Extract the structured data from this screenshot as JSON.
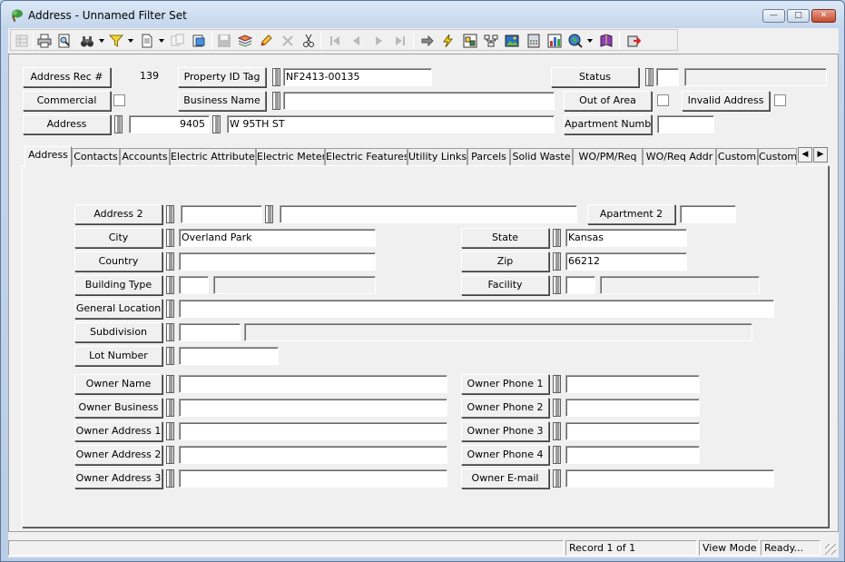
{
  "window": {
    "title": "Address - Unnamed Filter Set",
    "min": "—",
    "max": "□",
    "close": "✕"
  },
  "colors": {
    "accent": "#1e5fa8",
    "window_frame": "#5d7698",
    "close": "#c44a2f"
  },
  "toolbar": {
    "icons": [
      "table-icon",
      "print-icon",
      "print-preview-icon",
      "binoculars-icon",
      "filter-icon",
      "document-icon",
      "copy-icon",
      "open-icon",
      "save-icon",
      "layers-icon",
      "edit-icon",
      "delete-icon",
      "cut-icon",
      "first-record-icon",
      "previous-record-icon",
      "next-record-icon",
      "last-record-icon",
      "go-icon",
      "lightning-icon",
      "map-icon",
      "hierarchy-icon",
      "image-icon",
      "calculator-icon",
      "chart-icon",
      "globe-icon",
      "book-icon",
      "exit-icon"
    ]
  },
  "header": {
    "address_rec_label": "Address Rec #",
    "address_rec_value": "139",
    "property_id_label": "Property ID Tag",
    "property_id_value": "NF2413-00135",
    "status_label": "Status",
    "status_code": "",
    "status_desc": "",
    "commercial_label": "Commercial",
    "business_name_label": "Business Name",
    "business_name_value": "",
    "out_of_area_label": "Out of Area",
    "invalid_address_label": "Invalid Address",
    "address_label": "Address",
    "address_number": "9405",
    "address_street": "W 95TH ST",
    "apartment_number_label": "Apartment Number",
    "apartment_number_value": ""
  },
  "tabs": [
    "Address",
    "Contacts",
    "Accounts",
    "Electric Attributes",
    "Electric Meter",
    "Electric Features",
    "Utility Links",
    "Parcels",
    "Solid Waste",
    "WO/PM/Req",
    "WO/Req Addr",
    "Custom",
    "Custom"
  ],
  "tab_scroll": {
    "left": "◀",
    "right": "▶"
  },
  "detail": {
    "address2_label": "Address 2",
    "address2_a": "",
    "address2_b": "",
    "apartment2_label": "Apartment 2",
    "apartment2_value": "",
    "city_label": "City",
    "city_value": "Overland Park",
    "state_label": "State",
    "state_value": "Kansas",
    "country_label": "Country",
    "country_value": "",
    "zip_label": "Zip",
    "zip_value": "66212",
    "building_type_label": "Building Type",
    "building_type_code": "",
    "building_type_desc": "",
    "facility_label": "Facility",
    "facility_code": "",
    "facility_desc": "",
    "general_location_label": "General Location",
    "general_location_value": "",
    "subdivision_label": "Subdivision",
    "subdivision_code": "",
    "subdivision_desc": "",
    "lot_number_label": "Lot Number",
    "lot_number_value": "",
    "owner_name_label": "Owner Name",
    "owner_name_value": "",
    "owner_business_label": "Owner Business",
    "owner_business_value": "",
    "owner_address1_label": "Owner Address 1",
    "owner_address1_value": "",
    "owner_address2_label": "Owner Address 2",
    "owner_address2_value": "",
    "owner_address3_label": "Owner Address 3",
    "owner_address3_value": "",
    "owner_phone1_label": "Owner Phone 1",
    "owner_phone1_value": "",
    "owner_phone2_label": "Owner Phone 2",
    "owner_phone2_value": "",
    "owner_phone3_label": "Owner Phone 3",
    "owner_phone3_value": "",
    "owner_phone4_label": "Owner Phone 4",
    "owner_phone4_value": "",
    "owner_email_label": "Owner E-mail",
    "owner_email_value": ""
  },
  "statusbar": {
    "record": "Record 1 of 1",
    "mode": "View Mode",
    "state": "Ready..."
  }
}
